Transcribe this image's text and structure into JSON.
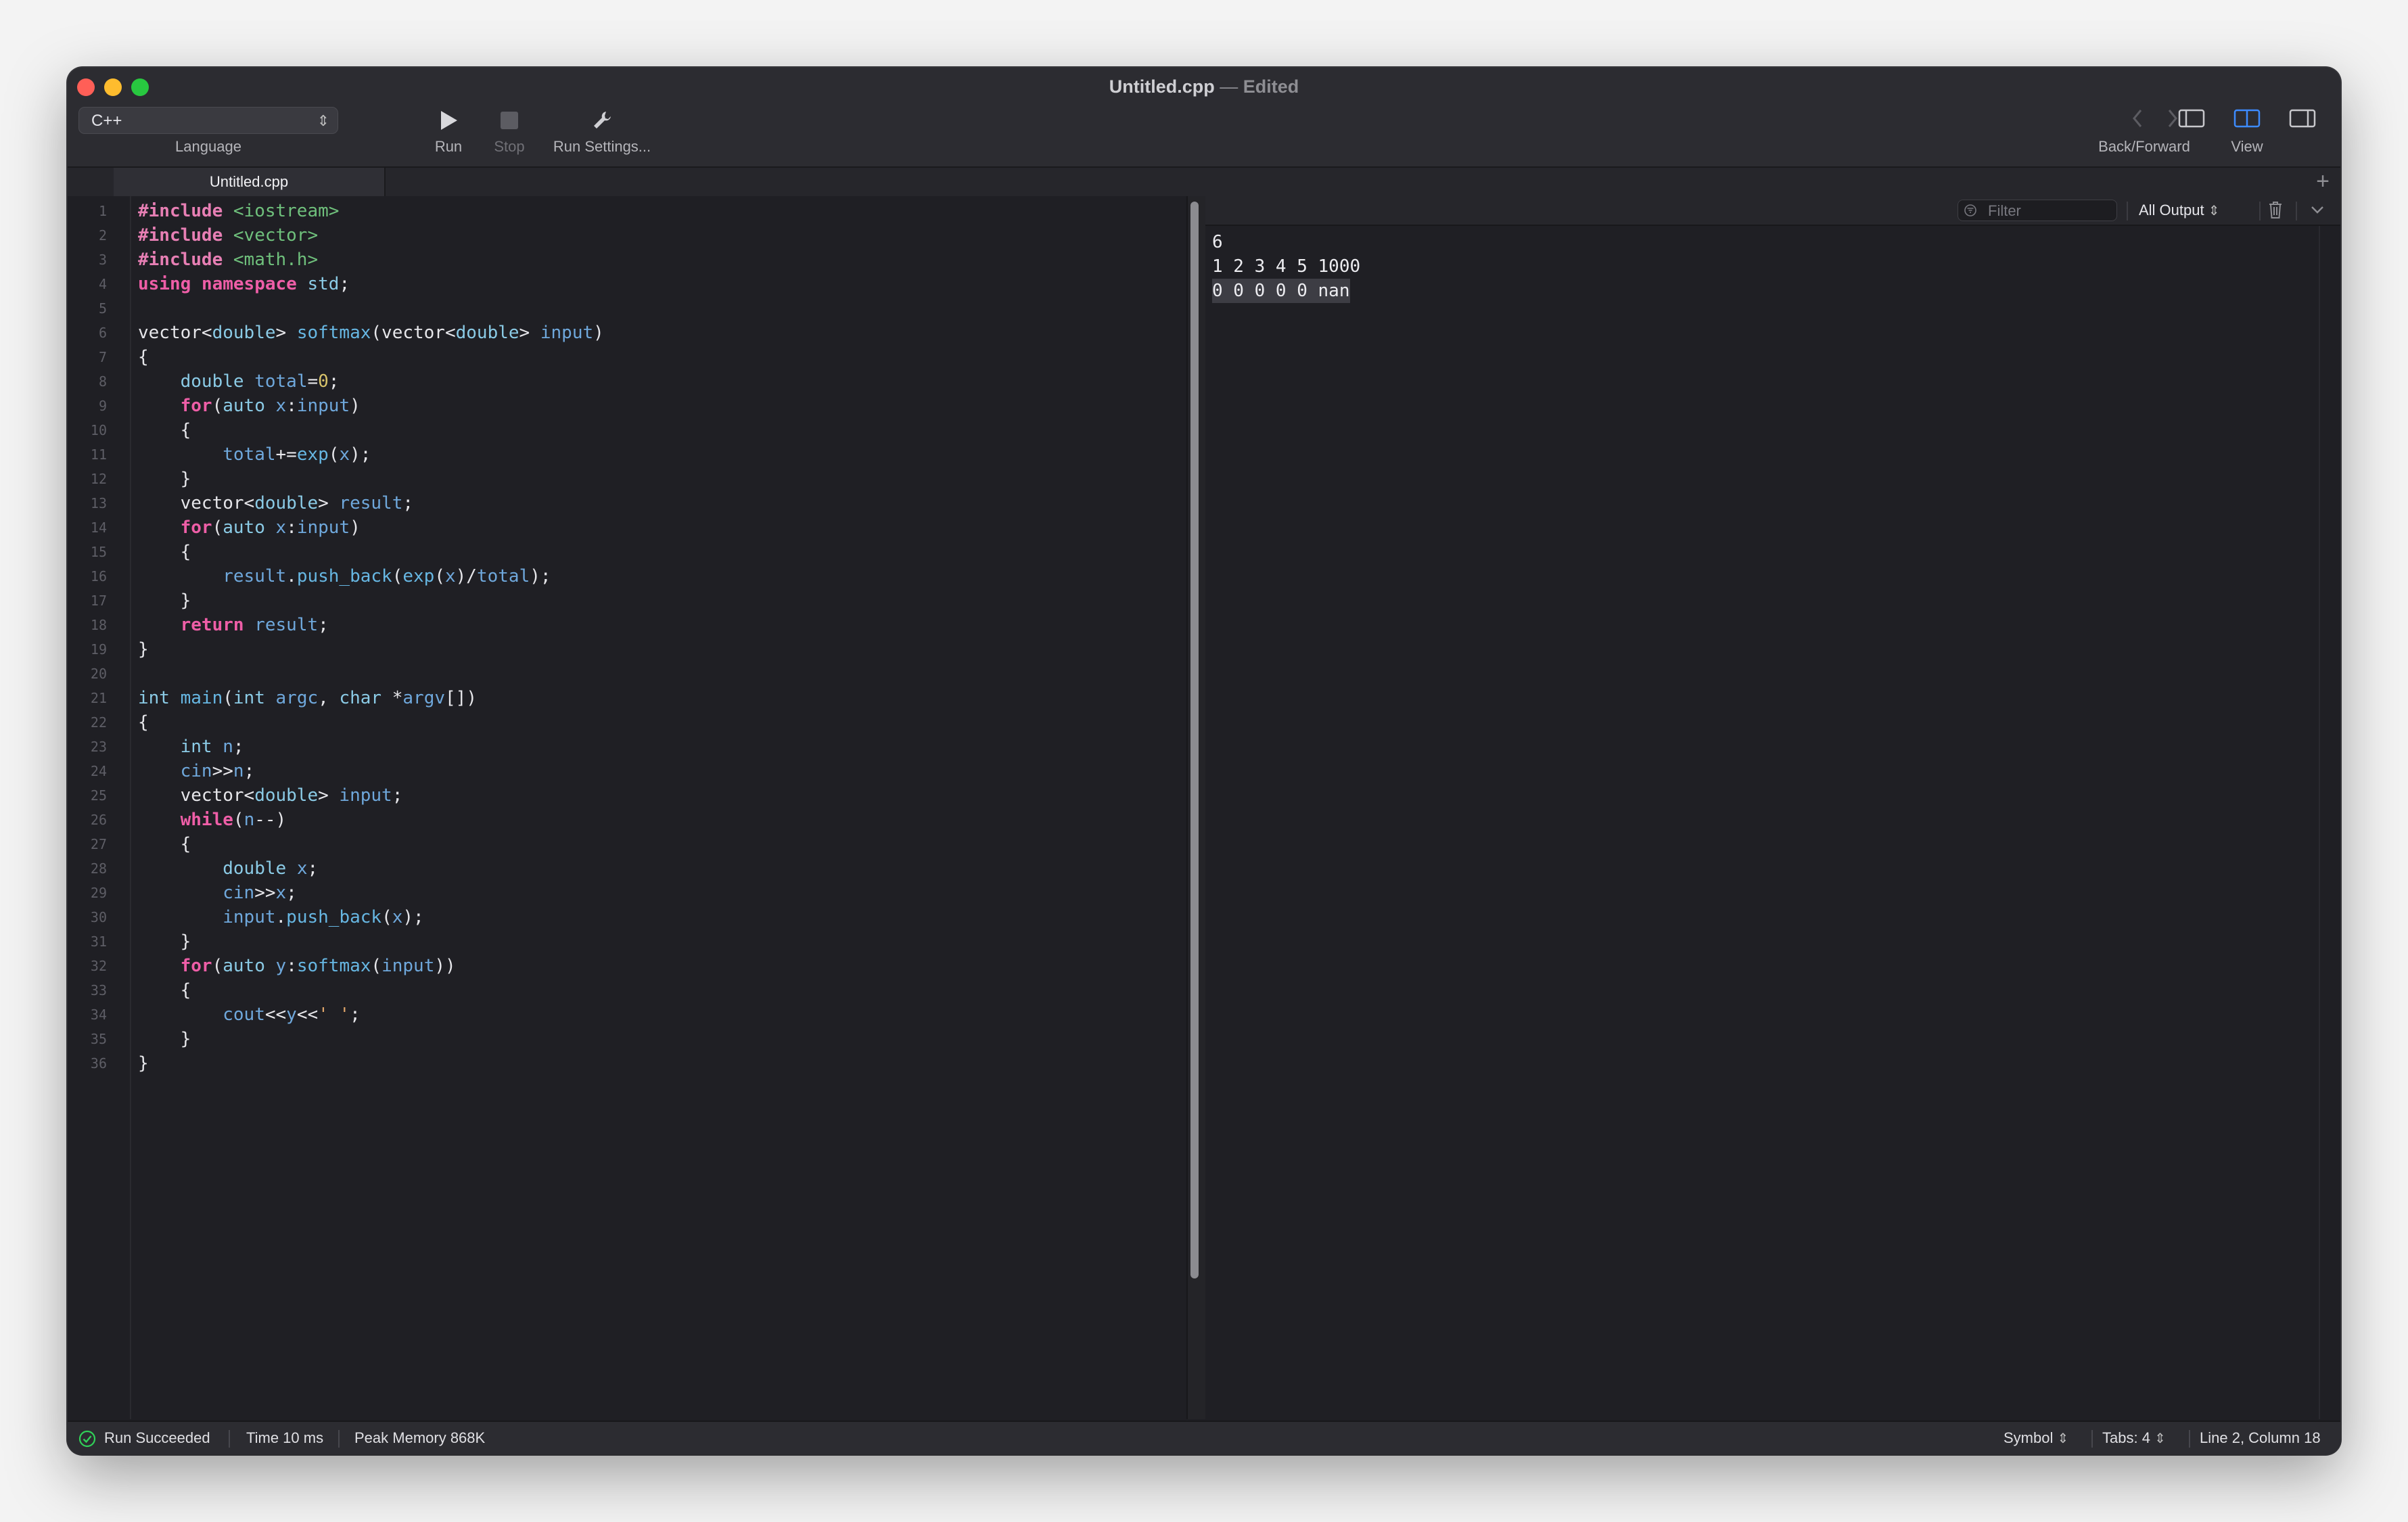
{
  "window": {
    "title": "Untitled.cpp",
    "title_separator": "—",
    "title_status": "Edited"
  },
  "toolbar": {
    "language_value": "C++",
    "language_label": "Language",
    "run_label": "Run",
    "stop_label": "Stop",
    "run_settings_label": "Run Settings...",
    "back_forward_label": "Back/Forward",
    "view_label": "View"
  },
  "tabs": [
    {
      "label": "Untitled.cpp",
      "active": true
    }
  ],
  "editor": {
    "line_numbers": [
      "1",
      "2",
      "3",
      "4",
      "5",
      "6",
      "7",
      "8",
      "9",
      "10",
      "11",
      "12",
      "13",
      "14",
      "15",
      "16",
      "17",
      "18",
      "19",
      "20",
      "21",
      "22",
      "23",
      "24",
      "25",
      "26",
      "27",
      "28",
      "29",
      "30",
      "31",
      "32",
      "33",
      "34",
      "35",
      "36"
    ]
  },
  "console": {
    "filter_placeholder": "Filter",
    "output_scope": "All Output",
    "output_lines": [
      "6",
      "1 2 3 4 5 1000",
      "0 0 0 0 0 nan"
    ]
  },
  "status": {
    "run_result": "Run Succeeded",
    "time": "Time 10 ms",
    "peak_memory": "Peak Memory 868K",
    "symbol": "Symbol",
    "tabs": "Tabs: 4",
    "cursor": "Line 2, Column 18"
  },
  "colors": {
    "close": "#ff5f57",
    "minimize": "#febc2e",
    "zoom": "#28c840",
    "keyword": "#ee5ea7",
    "type": "#8bcbe6",
    "function": "#67b7e3",
    "header": "#6fc07c",
    "accent": "#3d8bff",
    "success": "#30d158"
  }
}
